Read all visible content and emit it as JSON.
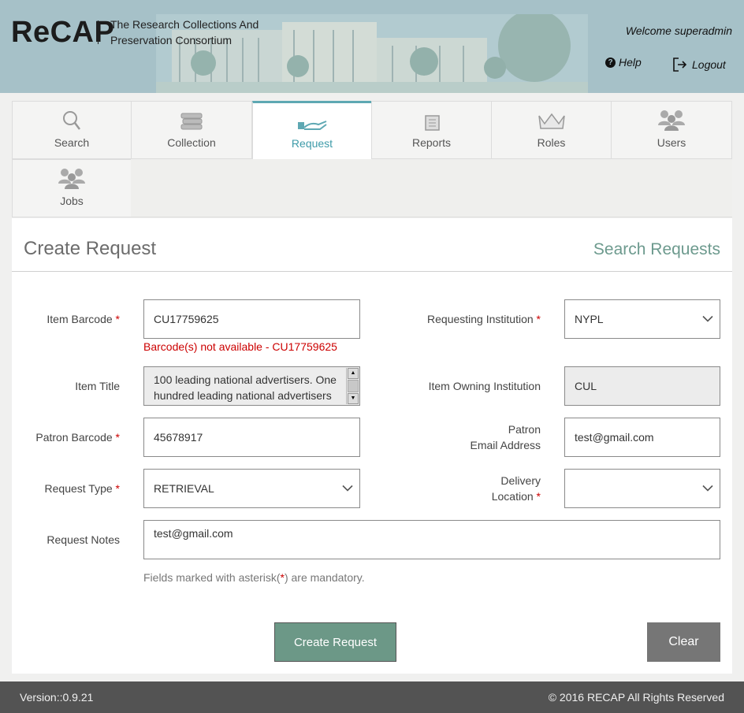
{
  "header": {
    "logo": "ReCAP",
    "consortium": "The Research Collections And Preservation Consortium",
    "welcome": "Welcome superadmin",
    "help_label": "Help",
    "logout_label": "Logout"
  },
  "nav": {
    "tabs": [
      {
        "label": "Search",
        "icon": "search-icon",
        "active": false
      },
      {
        "label": "Collection",
        "icon": "books-icon",
        "active": false
      },
      {
        "label": "Request",
        "icon": "hand-book-icon",
        "active": true
      },
      {
        "label": "Reports",
        "icon": "document-icon",
        "active": false
      },
      {
        "label": "Roles",
        "icon": "crown-icon",
        "active": false
      },
      {
        "label": "Users",
        "icon": "users-icon",
        "active": false
      },
      {
        "label": "Jobs",
        "icon": "users-icon",
        "active": false
      }
    ]
  },
  "form": {
    "title": "Create Request",
    "search_link": "Search Requests",
    "item_barcode": {
      "label": "Item Barcode",
      "value": "CU17759625",
      "error": "Barcode(s) not available - CU17759625"
    },
    "item_title": {
      "label": "Item Title",
      "value": "100 leading national advertisers. One hundred leading national advertisers"
    },
    "patron_barcode": {
      "label": "Patron Barcode",
      "value": "45678917"
    },
    "request_type": {
      "label": "Request Type",
      "value": "RETRIEVAL"
    },
    "request_notes": {
      "label": "Request Notes",
      "value": "test@gmail.com"
    },
    "requesting_institution": {
      "label": "Requesting Institution",
      "value": "NYPL"
    },
    "owning_institution": {
      "label": "Item Owning Institution",
      "value": "CUL"
    },
    "patron_email": {
      "label_line1": "Patron",
      "label_line2": "Email Address",
      "value": "test@gmail.com"
    },
    "delivery_location": {
      "label_line1": "Delivery",
      "label_line2": "Location",
      "value": ""
    },
    "asterisk": "*",
    "hint_before": "Fields marked with asterisk(",
    "hint_after": ") are mandatory.",
    "create_button": "Create Request",
    "clear_button": "Clear"
  },
  "footer": {
    "version": "Version::0.9.21",
    "copyright": "© 2016 RECAP All Rights Reserved"
  },
  "colors": {
    "header_bg": "#a6c1c8",
    "accent": "#6c9887",
    "active_tab": "#3e9ba9",
    "error": "#cc0000",
    "footer_bg": "#535353"
  }
}
